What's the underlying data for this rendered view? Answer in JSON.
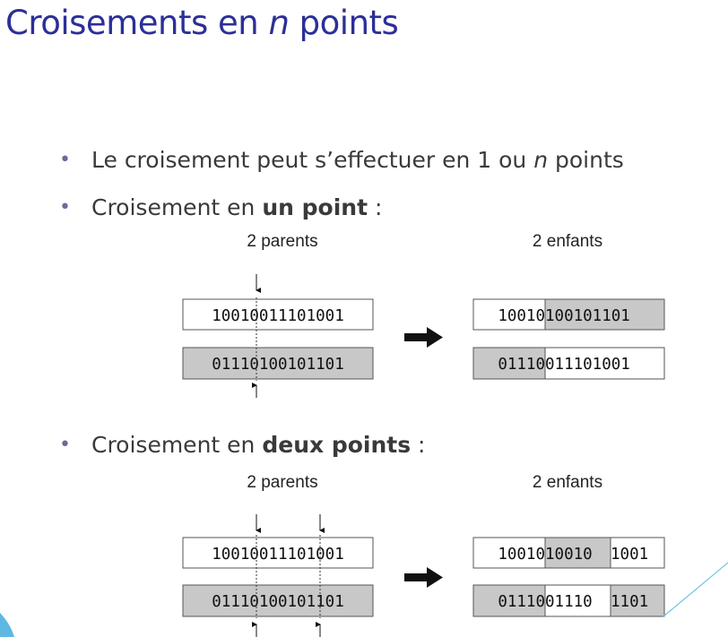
{
  "title": {
    "pre": "Croisements en ",
    "italic": "n",
    "post": " points"
  },
  "bullets": {
    "b1": {
      "pre": "Le croisement peut s’effectuer en 1 ou ",
      "italic": "n",
      "post": " points"
    },
    "b2": {
      "pre": "Croisement en ",
      "bold": "un point",
      "post": " :"
    },
    "b3": {
      "pre": "Croisement en ",
      "bold": "deux points",
      "post": " :"
    }
  },
  "bullet_char": "•",
  "captions": {
    "parents": "2 parents",
    "children": "2 enfants"
  },
  "one_point": {
    "parent1": "10010011101001",
    "parent2": "01110100101101",
    "child1": {
      "a": "10010",
      "b": "100101101"
    },
    "child2": {
      "a": "01110",
      "b": "011101001"
    }
  },
  "two_points": {
    "parent1": "10010011101001",
    "parent2": "01110100101101",
    "child1": {
      "a": "10010",
      "b": "10010",
      "c": "1001"
    },
    "child2": {
      "a": "01110",
      "b": "01110",
      "c": "1101"
    }
  },
  "colors": {
    "title": "#2b2f98",
    "grey_fill": "#c8c8c8",
    "accent_line": "#6fc6e8"
  }
}
